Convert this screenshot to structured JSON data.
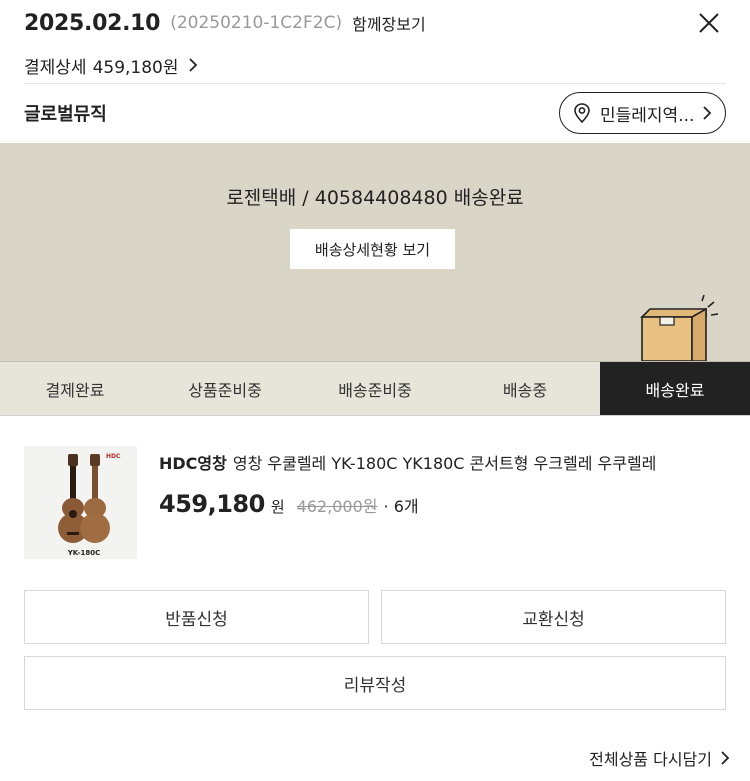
{
  "header": {
    "order_date": "2025.02.10",
    "order_number": "(20250210-1C2F2C)",
    "view_together": "함께장보기",
    "payment_label": "결제상세",
    "payment_amount": "459,180원"
  },
  "store": {
    "name": "글로벌뮤직",
    "inquiry_label": "민들레지역..."
  },
  "delivery": {
    "tracking_text": "로젠택배 / 40584408480 배송완료",
    "detail_button": "배송상세현황 보기",
    "banner_color": "#d9d6c8"
  },
  "steps": [
    {
      "label": "결제완료",
      "active": false
    },
    {
      "label": "상품준비중",
      "active": false
    },
    {
      "label": "배송준비중",
      "active": false
    },
    {
      "label": "배송중",
      "active": false
    },
    {
      "label": "배송완료",
      "active": true
    }
  ],
  "product": {
    "brand": "HDC영창",
    "name": "영창 우쿨렐레 YK-180C YK180C 콘서트형 우크렐레 우쿠렐레",
    "price": "459,180",
    "currency": "원",
    "original_price": "462,000원",
    "quantity": "· 6개",
    "thumb_model": "YK-180C",
    "thumb_logo": "HDC"
  },
  "actions": {
    "return_label": "반품신청",
    "exchange_label": "교환신청",
    "review_label": "리뷰작성",
    "recart_label": "전체상품 다시담기"
  }
}
